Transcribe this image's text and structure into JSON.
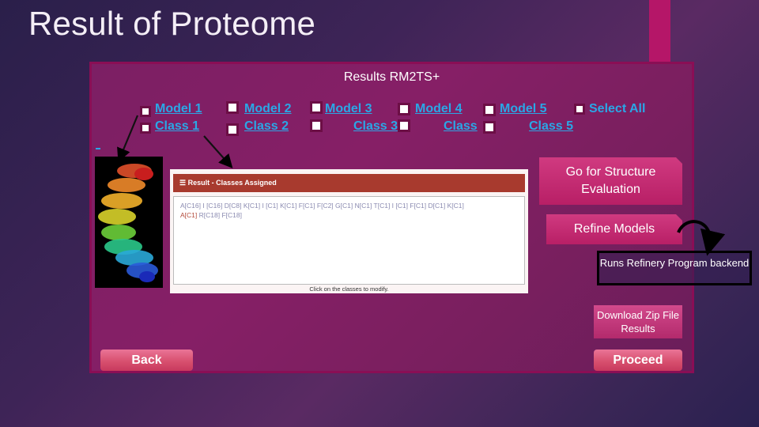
{
  "slide": {
    "title": "Result of Proteome"
  },
  "panel": {
    "title": "Results RM2TS+",
    "models": [
      {
        "label": "Model 1 "
      },
      {
        "label": "Model 2 "
      },
      {
        "label": "Model 3 "
      },
      {
        "label": "Model 4"
      },
      {
        "label": "Model 5 "
      }
    ],
    "classes": [
      {
        "label": "Class 1 "
      },
      {
        "label": "Class 2 "
      },
      {
        "label": "Class 3"
      },
      {
        "label": "Class"
      },
      {
        "label": "Class 5 "
      }
    ],
    "select_all": "Select All",
    "result_card": {
      "header": "☰ Result - Classes Assigned",
      "sequence_line1": "A[C16] I [C16] D[C8] K[C1] I [C1] K[C1] F[C1] F[C2] G[C1] N[C1] T[C1] I [C1] F[C1] D[C1] K[C1]",
      "sequence_line2_red": "A[C1]",
      "sequence_line2_rest": " R[C18] F[C18]",
      "footer": "Click on the classes to modify."
    },
    "buttons": {
      "structure_eval": "Go for Structure Evaluation",
      "refine": "Refine Models",
      "download": "Download Zip File Results",
      "back": "Back",
      "proceed": "Proceed"
    },
    "note": "Runs Refinery Program backend"
  },
  "colors": {
    "link": "#2aa7e6",
    "accent": "#b51668",
    "panel": "#861f66",
    "card_header": "#a83a2e"
  }
}
